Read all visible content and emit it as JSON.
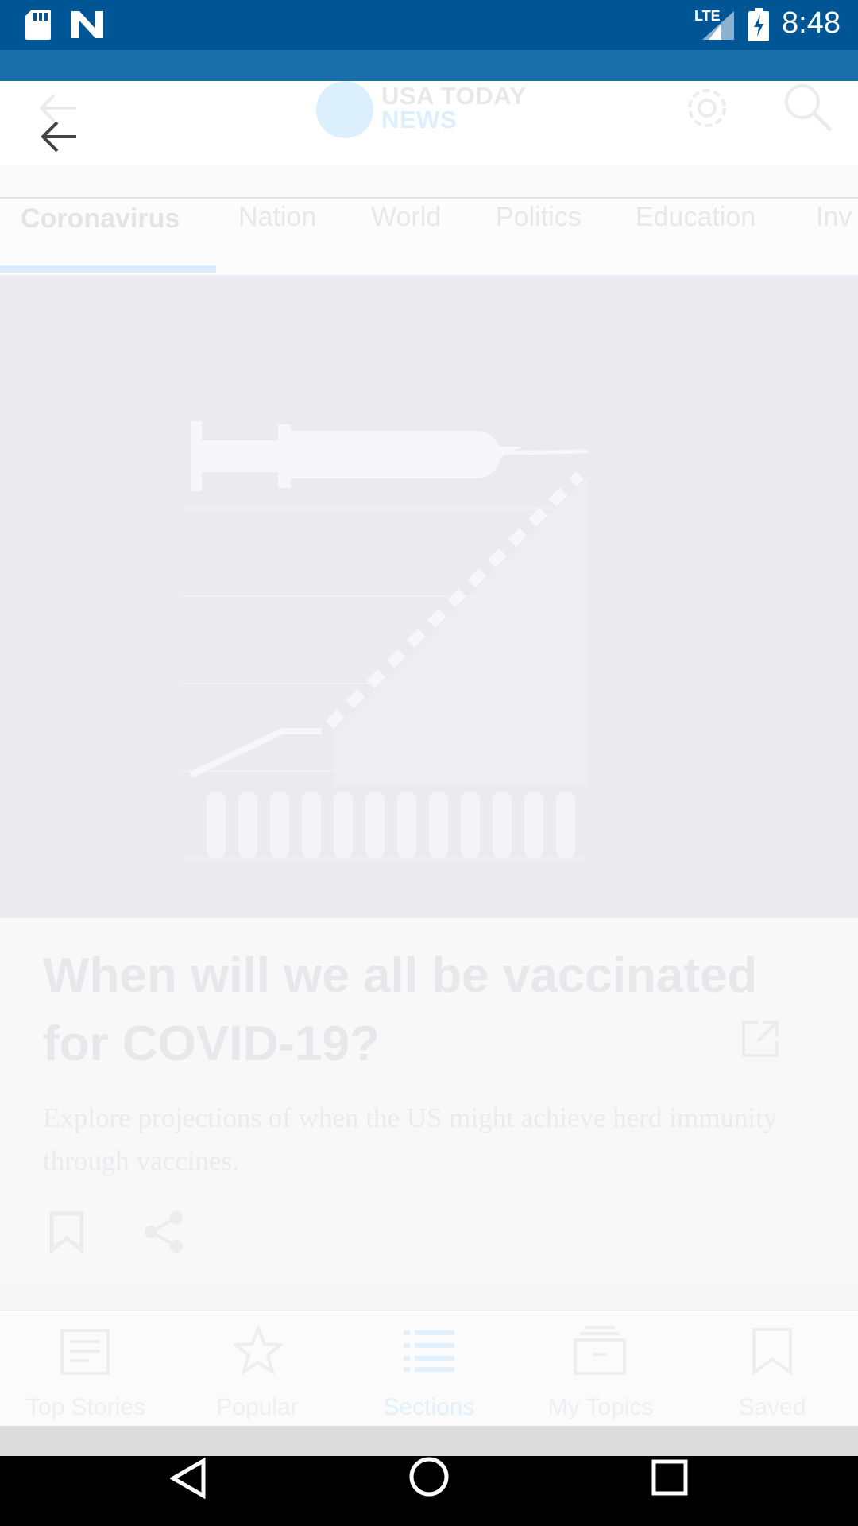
{
  "status_bar": {
    "time": "8:48",
    "network": "LTE",
    "icons": [
      "sd-card-icon",
      "n-notification-icon",
      "signal-icon",
      "battery-charging-icon"
    ],
    "background": "#005594"
  },
  "header": {
    "brand_line1": "USA TODAY",
    "brand_line2": "NEWS",
    "icons": [
      "back-arrow-icon",
      "gear-icon",
      "search-icon"
    ]
  },
  "tabs": [
    {
      "label": "Coronavirus",
      "active": true
    },
    {
      "label": "Nation",
      "active": false
    },
    {
      "label": "World",
      "active": false
    },
    {
      "label": "Politics",
      "active": false
    },
    {
      "label": "Education",
      "active": false
    },
    {
      "label": "Inv",
      "active": false
    }
  ],
  "article": {
    "title": "When will we all be vaccinated for COVID-19?",
    "description": "Explore projections of when the US might achieve herd immunity through vaccines.",
    "hero_icon": "syringe-chart-illustration",
    "actions": [
      "bookmark-icon",
      "share-icon",
      "external-link-icon"
    ]
  },
  "bottom_nav": [
    {
      "label": "Top Stories",
      "icon": "top-stories-icon",
      "active": false
    },
    {
      "label": "Popular",
      "icon": "star-icon",
      "active": false
    },
    {
      "label": "Sections",
      "icon": "list-icon",
      "active": true
    },
    {
      "label": "My Topics",
      "icon": "topics-icon",
      "active": false
    },
    {
      "label": "Saved",
      "icon": "bookmark-icon",
      "active": false
    }
  ],
  "system_nav": [
    "back-triangle-icon",
    "home-circle-icon",
    "recents-square-icon"
  ]
}
